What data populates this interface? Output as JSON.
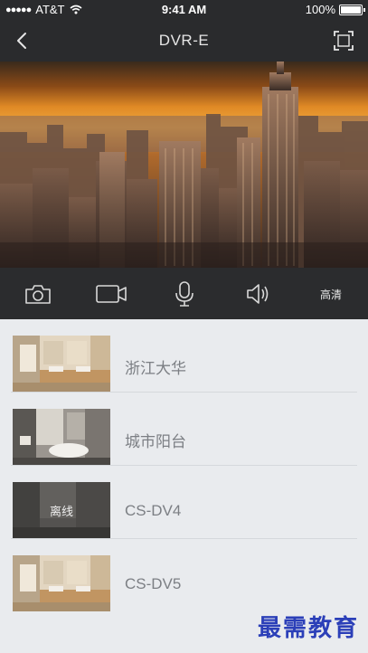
{
  "status_bar": {
    "carrier": "AT&T",
    "time": "9:41 AM",
    "battery_text": "100%",
    "battery_level": 1.0
  },
  "nav": {
    "title": "DVR-E",
    "back_icon": "chevron-left-icon",
    "fullscreen_icon": "fullscreen-icon"
  },
  "toolbar": {
    "snapshot_icon": "camera-icon",
    "record_icon": "video-record-icon",
    "talk_icon": "microphone-icon",
    "audio_icon": "speaker-icon",
    "quality_label": "高清"
  },
  "devices": [
    {
      "name": "浙江大华",
      "offline": false
    },
    {
      "name": "城市阳台",
      "offline": false
    },
    {
      "name": "CS-DV4",
      "offline": true,
      "status_label": "离线"
    },
    {
      "name": "CS-DV5",
      "offline": false
    }
  ],
  "watermark": "最需教育",
  "colors": {
    "bar_dark": "#2a2b2d",
    "list_bg": "#e9ebee",
    "device_text": "#7c7f84",
    "watermark": "#2b3fb8"
  }
}
